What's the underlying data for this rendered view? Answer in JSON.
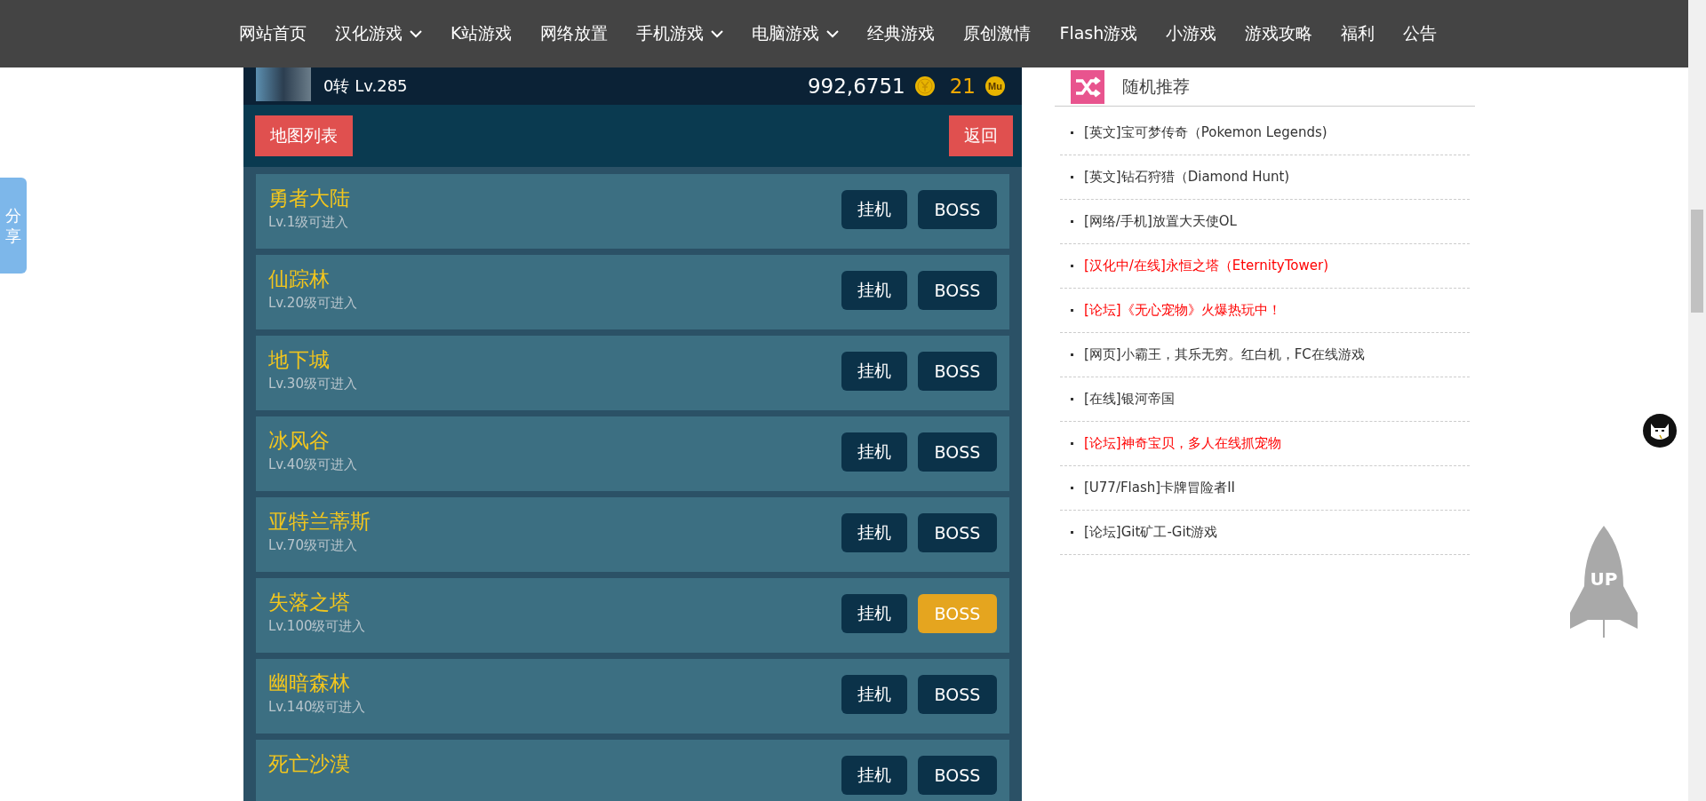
{
  "nav": [
    {
      "label": "网站首页",
      "dropdown": false
    },
    {
      "label": "汉化游戏",
      "dropdown": true
    },
    {
      "label": "K站游戏",
      "dropdown": false
    },
    {
      "label": "网络放置",
      "dropdown": false
    },
    {
      "label": "手机游戏",
      "dropdown": true
    },
    {
      "label": "电脑游戏",
      "dropdown": true
    },
    {
      "label": "经典游戏",
      "dropdown": false
    },
    {
      "label": "原创激情",
      "dropdown": false
    },
    {
      "label": "Flash游戏",
      "dropdown": false
    },
    {
      "label": "小游戏",
      "dropdown": false
    },
    {
      "label": "游戏攻略",
      "dropdown": false
    },
    {
      "label": "福利",
      "dropdown": false
    },
    {
      "label": "公告",
      "dropdown": false
    }
  ],
  "game": {
    "player": {
      "level": "0转 Lv.285",
      "gold": "992,6751",
      "gems": "21",
      "gem_coin_label": "Mu"
    },
    "toolbar": {
      "map_list": "地图列表",
      "back": "返回"
    },
    "maps": [
      {
        "name": "勇者大陆",
        "requirement": "Lv.1级可进入",
        "idle": "挂机",
        "boss": "BOSS",
        "selected": false
      },
      {
        "name": "仙踪林",
        "requirement": "Lv.20级可进入",
        "idle": "挂机",
        "boss": "BOSS",
        "selected": false
      },
      {
        "name": "地下城",
        "requirement": "Lv.30级可进入",
        "idle": "挂机",
        "boss": "BOSS",
        "selected": false
      },
      {
        "name": "冰风谷",
        "requirement": "Lv.40级可进入",
        "idle": "挂机",
        "boss": "BOSS",
        "selected": false
      },
      {
        "name": "亚特兰蒂斯",
        "requirement": "Lv.70级可进入",
        "idle": "挂机",
        "boss": "BOSS",
        "selected": false
      },
      {
        "name": "失落之塔",
        "requirement": "Lv.100级可进入",
        "idle": "挂机",
        "boss": "BOSS",
        "selected": true
      },
      {
        "name": "幽暗森林",
        "requirement": "Lv.140级可进入",
        "idle": "挂机",
        "boss": "BOSS",
        "selected": false
      },
      {
        "name": "死亡沙漠",
        "idle": "挂机",
        "boss": "BOSS",
        "selected": false
      }
    ]
  },
  "sidebar": {
    "title": "随机推荐",
    "items": [
      {
        "text": "[英文]宝可梦传奇（Pokemon Legends)",
        "color": "#333333"
      },
      {
        "text": "[英文]钻石狩猎（Diamond Hunt)",
        "color": "#333333"
      },
      {
        "text": "[网络/手机]放置大天使OL",
        "color": "#333333"
      },
      {
        "text": "[汉化中/在线]永恒之塔（EternityTower)",
        "color": "#ff0000"
      },
      {
        "text": "[论坛]《无心宠物》火爆热玩中！",
        "color": "#ff0000"
      },
      {
        "text": "[网页]小霸王，其乐无穷。红白机，FC在线游戏",
        "color": "#333333"
      },
      {
        "text": "[在线]银河帝国",
        "color": "#333333"
      },
      {
        "text": "[论坛]神奇宝贝，多人在线抓宠物",
        "color": "#ff0000"
      },
      {
        "text": "[U77/Flash]卡牌冒险者II",
        "color": "#333333"
      },
      {
        "text": "[论坛]Git矿工-Git游戏",
        "color": "#333333"
      }
    ]
  },
  "share_tab": "分享",
  "back_to_top": "UP"
}
